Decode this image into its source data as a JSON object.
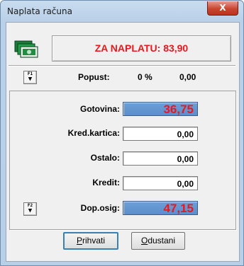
{
  "window": {
    "title": "Naplata računa",
    "close_glyph": "X"
  },
  "header": {
    "amount_label": "ZA NAPLATU:",
    "amount_value": "83,90",
    "icon": "money-icon",
    "accent": "#e6191e"
  },
  "discount": {
    "key": "F1",
    "label": "Popust:",
    "percent": "0 %",
    "value": "0,00"
  },
  "payments": [
    {
      "label": "Gotovina:",
      "value": "36,75",
      "highlight": true
    },
    {
      "label": "Kred.kartica:",
      "value": "0,00"
    },
    {
      "label": "Ostalo:",
      "value": "0,00"
    },
    {
      "label": "Kredit:",
      "value": "0,00"
    },
    {
      "label": "Dop.osig:",
      "value": "47,15",
      "highlight": true,
      "key": "F2"
    }
  ],
  "buttons": {
    "accept": {
      "mnemonic": "P",
      "rest": "rihvati"
    },
    "cancel": {
      "mnemonic": "O",
      "rest": "dustani"
    }
  },
  "colors": {
    "field_highlight": "#5b8ecb",
    "amount_text": "#e6191e"
  }
}
